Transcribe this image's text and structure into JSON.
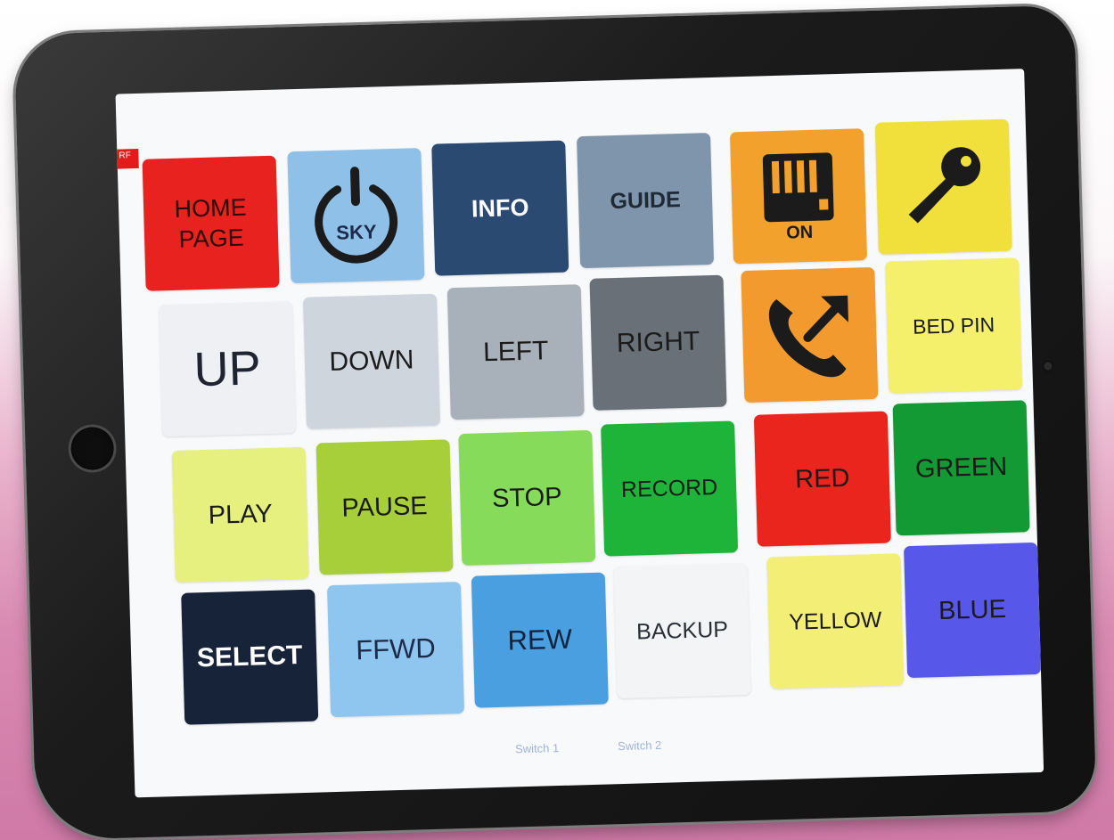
{
  "badge": "RF",
  "tiles": {
    "home_page": "HOME\nPAGE",
    "sky": "SKY",
    "info": "INFO",
    "guide": "GUIDE",
    "on": "ON",
    "up": "UP",
    "down": "DOWN",
    "left": "LEFT",
    "right": "RIGHT",
    "bed_pin": "BED PIN",
    "play": "PLAY",
    "pause": "PAUSE",
    "stop": "STOP",
    "record": "RECORD",
    "red": "RED",
    "green": "GREEN",
    "select": "SELECT",
    "ffwd": "FFWD",
    "rew": "REW",
    "backup": "BACKUP",
    "yellow": "YELLOW",
    "blue": "BLUE"
  },
  "icons": {
    "power": "power-icon",
    "heater": "heater-icon",
    "key": "key-icon",
    "phone": "phone-outgoing-icon"
  },
  "colors": {
    "home_page": "#e8231f",
    "sky": "#8fc1e8",
    "info": "#2a4a72",
    "guide": "#7f95ab",
    "on": "#f2a22c",
    "key": "#f1df3b",
    "up": "#eef0f3",
    "down": "#cfd5dc",
    "left": "#a8b1ba",
    "right": "#6a7077",
    "phone": "#f29a2e",
    "bed_pin": "#f4f06c",
    "play": "#e5f07e",
    "pause": "#a7cf3a",
    "stop": "#86dc5a",
    "record": "#1eb43a",
    "red": "#e9251d",
    "green": "#139a34",
    "select": "#162339",
    "ffwd": "#8ec6ef",
    "rew": "#4a9fe0",
    "backup": "#f3f4f5",
    "yellow": "#f3ef76",
    "blue": "#5757e9"
  },
  "tabs": [
    "Switch 1",
    "Switch 2"
  ]
}
